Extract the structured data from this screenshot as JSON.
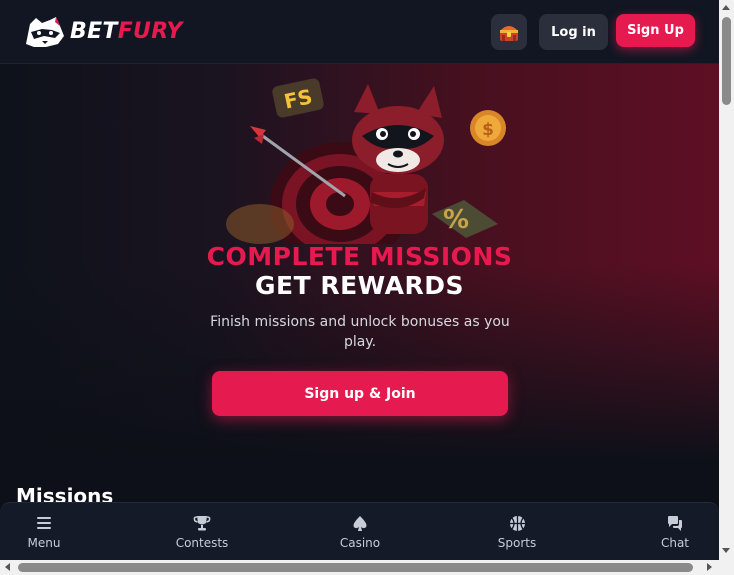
{
  "header": {
    "logo_bet": "BET",
    "logo_fury": "FURY",
    "login_label": "Log in",
    "signup_label": "Sign Up"
  },
  "hero": {
    "title_line1": "COMPLETE MISSIONS",
    "title_line2": "GET REWARDS",
    "subtitle": "Finish missions and unlock bonuses as you play.",
    "cta_label": "Sign up & Join",
    "art_badge_fs": "FS",
    "art_coin_symbol": "$",
    "art_percent_symbol": "%"
  },
  "section": {
    "missions_title": "Missions"
  },
  "bottom_nav": {
    "items": [
      {
        "label": "Menu",
        "icon": "menu-icon"
      },
      {
        "label": "Contests",
        "icon": "trophy-icon"
      },
      {
        "label": "Casino",
        "icon": "spade-icon"
      },
      {
        "label": "Sports",
        "icon": "basketball-icon"
      },
      {
        "label": "Chat",
        "icon": "chat-icon"
      }
    ]
  },
  "colors": {
    "accent": "#e51a4f",
    "background": "#0d1018",
    "header_bg": "#111622",
    "button_dark": "#2a2f3b"
  }
}
